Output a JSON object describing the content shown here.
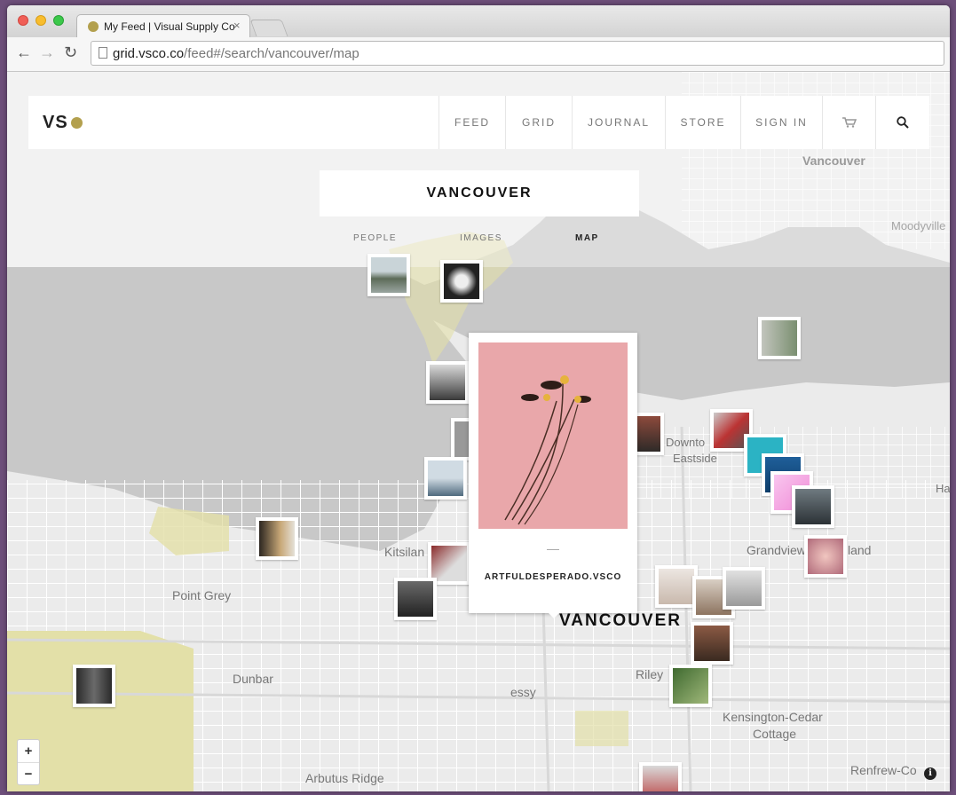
{
  "browser": {
    "tab_title": "My Feed | Visual Supply Co",
    "tab_close": "×",
    "url_domain": "grid.vsco.co",
    "url_path": "/feed#/search/vancouver/map"
  },
  "site": {
    "logo": "VS",
    "nav": {
      "feed": "FEED",
      "grid": "GRID",
      "journal": "JOURNAL",
      "store": "STORE",
      "sign_in": "SIGN IN"
    }
  },
  "search": {
    "title": "VANCOUVER",
    "tabs": {
      "people": "PEOPLE",
      "images": "IMAGES",
      "map": "MAP"
    },
    "active_tab": "MAP"
  },
  "popup": {
    "author": "ARTFULDESPERADO.VSCO"
  },
  "map_labels": {
    "vancouver_top": "Vancouver",
    "moodyville": "Moodyville",
    "downtown_eastside": "Downtown Eastside",
    "ha": "Ha",
    "grandview": "Grandview",
    "land": "land",
    "kitsilano": "Kitsilan",
    "point_grey": "Point Grey",
    "dunbar": "Dunbar",
    "vancouver_city": "VANCOUVER",
    "riley": "Riley",
    "essy": "essy",
    "kensington_cedar": "Kensington-Cedar",
    "cottage": "Cottage",
    "arbutus_ridge": "Arbutus Ridge",
    "renfrew": "Renfrew-Co"
  },
  "map_controls": {
    "zoom_in": "+",
    "zoom_out": "−",
    "info": "i"
  },
  "colors": {
    "accent": "#b3a04e",
    "water": "#c8c8c8",
    "land": "#ebebeb",
    "park": "#e3e0a8"
  }
}
